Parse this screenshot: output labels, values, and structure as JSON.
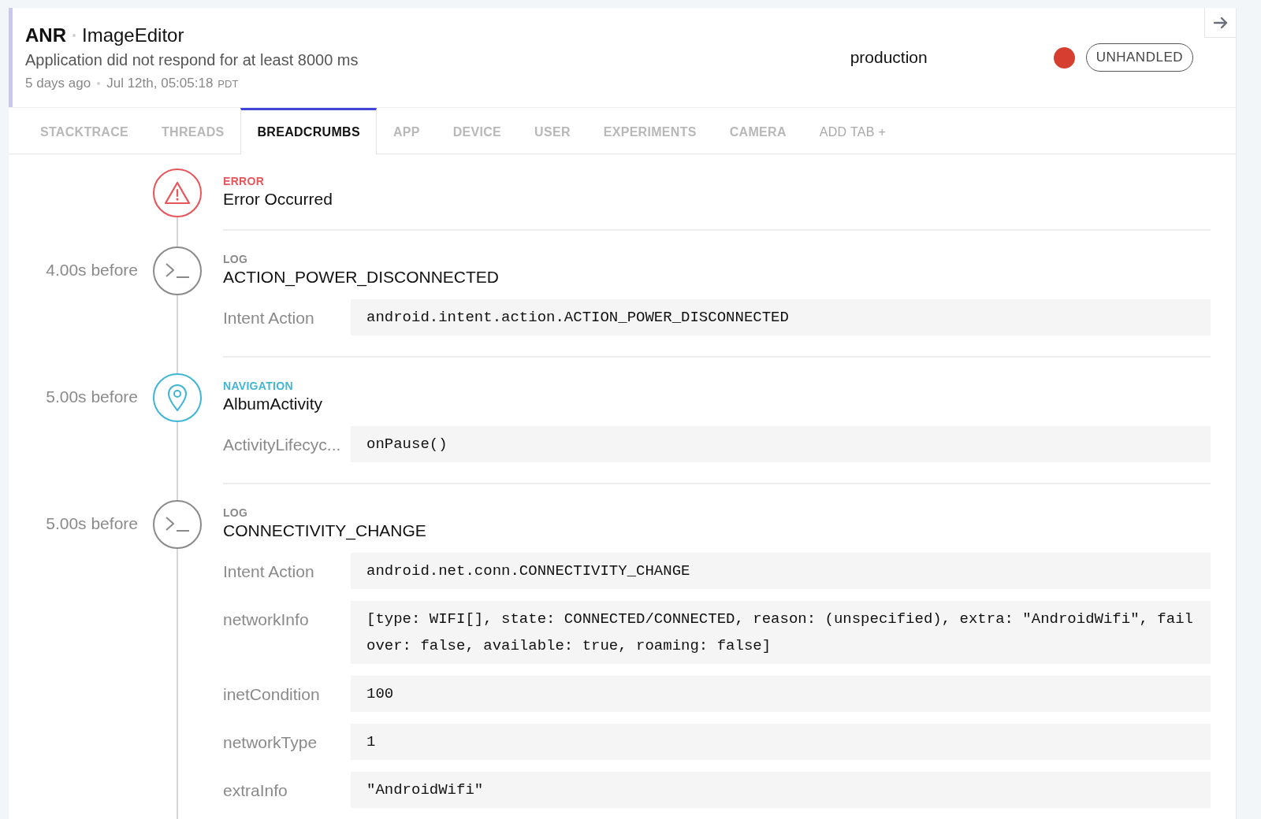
{
  "event": {
    "type": "ANR",
    "app": "ImageEditor",
    "message": "Application did not respond for at least 8000 ms",
    "relative_time": "5 days ago",
    "timestamp": "Jul 12th, 05:05:18",
    "timezone": "PDT",
    "environment": "production",
    "handled_badge": "UNHANDLED"
  },
  "tabs": [
    {
      "label": "STACKTRACE",
      "selected": false
    },
    {
      "label": "THREADS",
      "selected": false
    },
    {
      "label": "BREADCRUMBS",
      "selected": true
    },
    {
      "label": "APP",
      "selected": false
    },
    {
      "label": "DEVICE",
      "selected": false
    },
    {
      "label": "USER",
      "selected": false
    },
    {
      "label": "EXPERIMENTS",
      "selected": false
    },
    {
      "label": "CAMERA",
      "selected": false
    }
  ],
  "add_tab": "ADD TAB +",
  "breadcrumbs": [
    {
      "kind": "error",
      "category": "ERROR",
      "title": "Error Occurred"
    },
    {
      "kind": "log",
      "time": "4.00s before",
      "category": "LOG",
      "title": "ACTION_POWER_DISCONNECTED",
      "fields": [
        {
          "label": "Intent Action",
          "value": "android.intent.action.ACTION_POWER_DISCONNECTED"
        }
      ]
    },
    {
      "kind": "navigation",
      "time": "5.00s before",
      "category": "NAVIGATION",
      "title": "AlbumActivity",
      "fields": [
        {
          "label": "ActivityLifecyc...",
          "value": "onPause()"
        }
      ]
    },
    {
      "kind": "log",
      "time": "5.00s before",
      "category": "LOG",
      "title": "CONNECTIVITY_CHANGE",
      "fields": [
        {
          "label": "Intent Action",
          "value": "android.net.conn.CONNECTIVITY_CHANGE"
        },
        {
          "label": "networkInfo",
          "value": "[type: WIFI[], state: CONNECTED/CONNECTED, reason: (unspecified), extra: \"AndroidWifi\", failover: false, available: true, roaming: false]"
        },
        {
          "label": "inetCondition",
          "value": "100"
        },
        {
          "label": "networkType",
          "value": "1"
        },
        {
          "label": "extraInfo",
          "value": "\"AndroidWifi\""
        }
      ]
    }
  ]
}
